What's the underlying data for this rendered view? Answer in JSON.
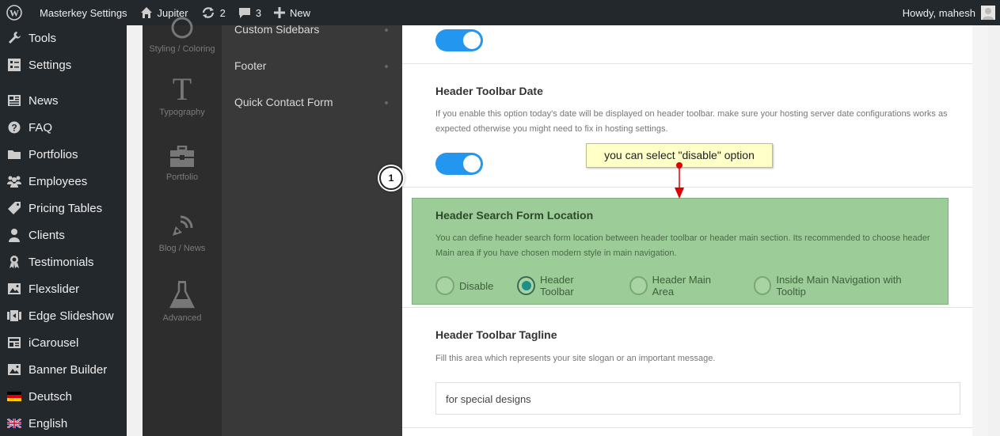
{
  "adminbar": {
    "site_name": "Masterkey Settings",
    "theme_name": "Jupiter",
    "updates_count": "2",
    "comments_count": "3",
    "new_label": "New",
    "greeting": "Howdy, mahesh"
  },
  "admin_menu": [
    {
      "label": "Tools",
      "icon": "wrench-icon"
    },
    {
      "label": "Settings",
      "icon": "settings-icon"
    },
    {
      "label": "News",
      "icon": "news-icon"
    },
    {
      "label": "FAQ",
      "icon": "question-icon"
    },
    {
      "label": "Portfolios",
      "icon": "folder-icon"
    },
    {
      "label": "Employees",
      "icon": "employees-icon"
    },
    {
      "label": "Pricing Tables",
      "icon": "tag-icon"
    },
    {
      "label": "Clients",
      "icon": "person-icon"
    },
    {
      "label": "Testimonials",
      "icon": "award-icon"
    },
    {
      "label": "Flexslider",
      "icon": "image-icon"
    },
    {
      "label": "Edge Slideshow",
      "icon": "slideshow-icon"
    },
    {
      "label": "iCarousel",
      "icon": "carousel-icon"
    },
    {
      "label": "Banner Builder",
      "icon": "image-icon"
    },
    {
      "label": "Deutsch",
      "icon": "flag-de-icon"
    },
    {
      "label": "English",
      "icon": "flag-uk-icon"
    }
  ],
  "option_categories": [
    {
      "label": "Styling / Coloring",
      "icon": "palette-icon"
    },
    {
      "label": "Typography",
      "icon": "typography-icon"
    },
    {
      "label": "Portfolio",
      "icon": "briefcase-icon"
    },
    {
      "label": "Blog / News",
      "icon": "rss-pen-icon"
    },
    {
      "label": "Advanced",
      "icon": "flask-icon"
    }
  ],
  "sub_sections": [
    {
      "label": "Custom Sidebars"
    },
    {
      "label": "Footer"
    },
    {
      "label": "Quick Contact Form"
    }
  ],
  "options": {
    "toolbar_date": {
      "title": "Header Toolbar Date",
      "description": "If you enable this option today's date will be displayed on header toolbar. make sure your hosting server date configurations works as expected otherwise you might need to fix in hosting settings."
    },
    "search_location": {
      "title": "Header Search Form Location",
      "description": "You can define header search form location between header toolbar or header main section. Its recommended to choose header Main area if you have chosen modern style in main navigation.",
      "choices": [
        "Disable",
        "Header Toolbar",
        "Header Main Area",
        "Inside Main Navigation with Tooltip"
      ],
      "selected": "Header Toolbar"
    },
    "toolbar_tagline": {
      "title": "Header Toolbar Tagline",
      "description": "Fill this area which represents your site slogan or an important message.",
      "value": "for special designs"
    }
  },
  "annotations": {
    "callout_text": "you can select \"disable\" option",
    "step_number": "1"
  },
  "colors": {
    "toggle_on": "#2396f0",
    "highlight": "#9ccc97",
    "radio_selected": "#1d8f84",
    "callout_bg": "#ffffc8",
    "arrow": "#e00000"
  }
}
